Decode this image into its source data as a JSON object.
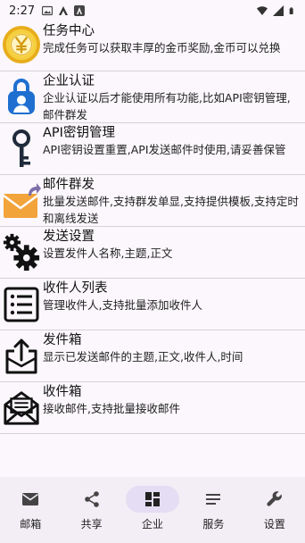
{
  "status": {
    "time": "2:27",
    "left_icons": [
      "image-icon",
      "a-icon",
      "a-box-icon"
    ],
    "right_icons": [
      "wifi-icon",
      "signal-icon",
      "battery-icon"
    ]
  },
  "items": [
    {
      "icon": "gold-coin-icon",
      "title": "任务中心",
      "desc": "完成任务可以获取丰厚的金币奖励,金币可以兑换"
    },
    {
      "icon": "enterprise-lock-icon",
      "title": "企业认证",
      "desc": "企业认证以后才能使用所有功能,比如API密钥管理,邮件群发"
    },
    {
      "icon": "key-icon",
      "title": "API密钥管理",
      "desc": "API密钥设置重置,API发送邮件时使用,请妥善保管"
    },
    {
      "icon": "mail-send-icon",
      "title": "邮件群发",
      "desc": "批量发送邮件,支持群发单显,支持提供模板,支持定时和离线发送"
    },
    {
      "icon": "gears-icon",
      "title": "发送设置",
      "desc": "设置发件人名称,主题,正文"
    },
    {
      "icon": "recipient-list-icon",
      "title": "收件人列表",
      "desc": "管理收件人,支持批量添加收件人"
    },
    {
      "icon": "outbox-icon",
      "title": "发件箱",
      "desc": "显示已发送邮件的主题,正文,收件人,时间"
    },
    {
      "icon": "inbox-icon",
      "title": "收件箱",
      "desc": "接收邮件,支持批量接收邮件"
    }
  ],
  "nav": {
    "active": 2,
    "items": [
      {
        "icon": "mail-icon",
        "label": "邮箱"
      },
      {
        "icon": "share-icon",
        "label": "共享"
      },
      {
        "icon": "dashboard-icon",
        "label": "企业"
      },
      {
        "icon": "menu-lines-icon",
        "label": "服务"
      },
      {
        "icon": "wrench-icon",
        "label": "设置"
      }
    ]
  },
  "colors": {
    "background": "#fbf7fc",
    "nav_background": "#f3edf5",
    "nav_active_pill": "#e4ddf3",
    "coin_gold": "#f2c230",
    "enterprise_blue": "#1e6fd0",
    "mail_orange": "#f2a33a"
  }
}
